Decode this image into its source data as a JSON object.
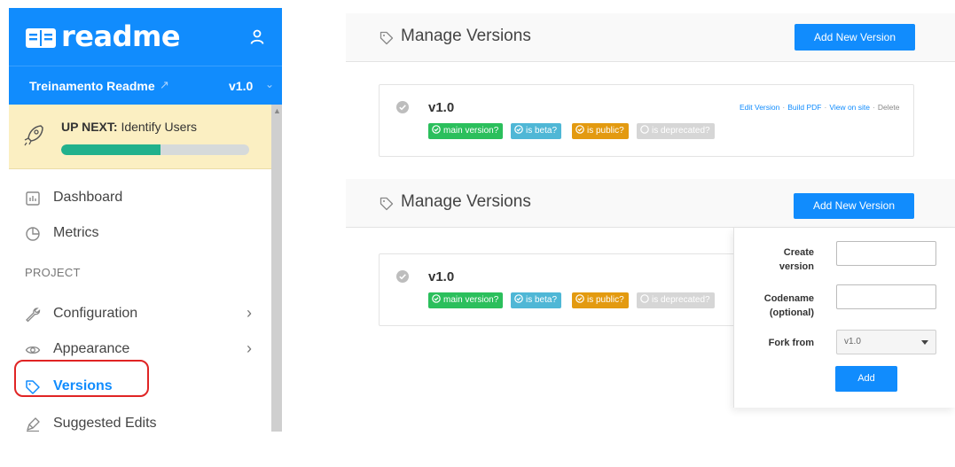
{
  "sidebar": {
    "brand": {
      "name": "readme",
      "logo_icon": "book-icon",
      "user_icon": "user-icon"
    },
    "project": {
      "name": "Treinamento Readme",
      "link_icon": "external-link-icon",
      "version": "v1.0",
      "version_icon": "chevron-down-icon"
    },
    "up_next": {
      "label": "UP NEXT:",
      "task": "Identify Users",
      "icon": "rocket-icon",
      "progress": 0.53
    },
    "nav": [
      {
        "label": "Dashboard",
        "icon": "dashboard-icon"
      },
      {
        "label": "Metrics",
        "icon": "pie-chart-icon"
      }
    ],
    "section_label": "PROJECT",
    "project_nav": [
      {
        "label": "Configuration",
        "icon": "wrench-icon",
        "has_chevron": true
      },
      {
        "label": "Appearance",
        "icon": "eye-icon",
        "has_chevron": true
      },
      {
        "label": "Versions",
        "icon": "tag-icon",
        "active": true
      },
      {
        "label": "Suggested Edits",
        "icon": "edit-icon"
      }
    ],
    "chevron_glyph": "›"
  },
  "panels": [
    {
      "title": "Manage Versions",
      "icon": "tag-icon",
      "add_button": "Add New Version",
      "card": {
        "version": "v1.0",
        "badges": {
          "main": "main version?",
          "beta": "is beta?",
          "public": "is public?",
          "deprecated": "is deprecated?"
        },
        "actions": {
          "edit": "Edit Version",
          "pdf": "Build PDF",
          "view": "View on site",
          "delete": "Delete",
          "separator": "·"
        }
      }
    },
    {
      "title": "Manage Versions",
      "icon": "tag-icon",
      "add_button": "Add New Version",
      "card": {
        "version": "v1.0",
        "badges": {
          "main": "main version?",
          "beta": "is beta?",
          "public": "is public?",
          "deprecated": "is deprecated?"
        }
      }
    }
  ],
  "create_form": {
    "create_label_1": "Create",
    "create_label_2": "version",
    "create_value": "",
    "codename_label_1": "Codename",
    "codename_label_2": "(optional)",
    "codename_value": "",
    "fork_label": "Fork from",
    "fork_value": "v1.0",
    "add_button": "Add"
  },
  "colors": {
    "brand_blue": "#118cfd",
    "badge_main": "#2bbf5c",
    "badge_beta": "#4fb7d6",
    "badge_public": "#e39a10",
    "badge_deprecated": "#d6d6d6",
    "progress": "#21b18c",
    "up_next_bg": "#fbefc2",
    "highlight": "#e02424"
  }
}
